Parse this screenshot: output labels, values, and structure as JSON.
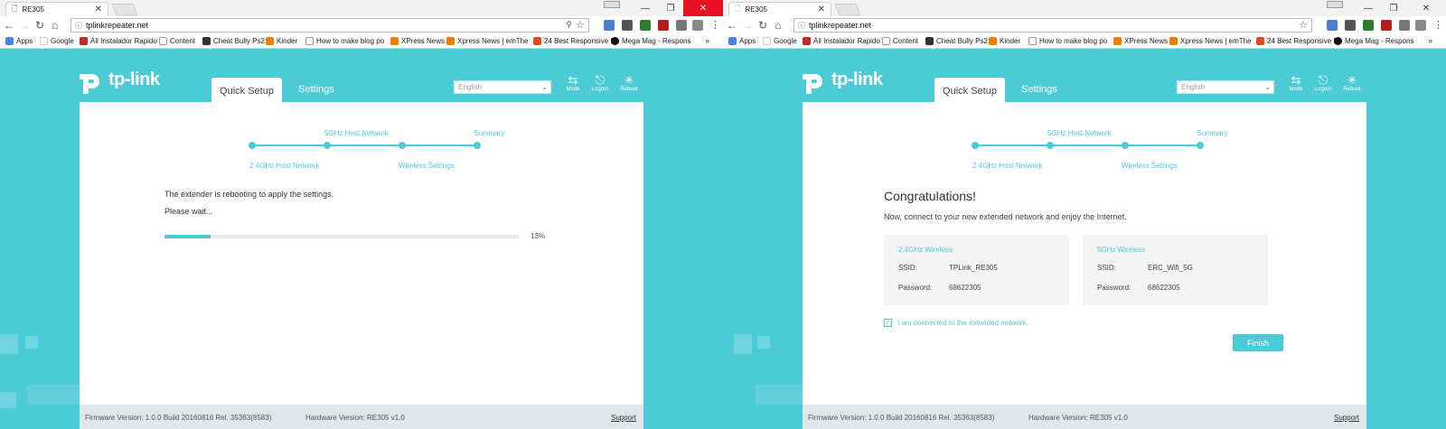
{
  "browser": {
    "tab_title": "RE305",
    "url": "tplinkrepeater.net",
    "bookmarks": [
      "Apps",
      "Google",
      "All Instalador Rapido",
      "Content",
      "Cheat Bully Ps2",
      "Kinder",
      "How to make blog po",
      "XPress News",
      "Xpress News | emThe",
      "24 Best Responsive Pr",
      "Mega Mag - Respons"
    ],
    "overflow": "»"
  },
  "router": {
    "brand": "tp-link",
    "tabs": [
      "Quick Setup",
      "Settings"
    ],
    "language": "English",
    "header_icons": [
      "Mode",
      "Logout",
      "Reboot"
    ],
    "steps_top": [
      "5GHz Host Network",
      "Summary"
    ],
    "steps_bottom": [
      "2.4GHz Host Network",
      "Wireless Settings"
    ],
    "footer": {
      "firmware": "Firmware Version: 1.0.0 Build 20160816 Rel. 35363(8583)",
      "hardware": "Hardware Version: RE305 v1.0",
      "support": "Support"
    }
  },
  "left": {
    "message": "The extender is rebooting to apply the settings.",
    "wait": "Please wait...",
    "progress_percent": 13,
    "progress_label": "13%"
  },
  "right": {
    "title": "Congratulations!",
    "subtitle": "Now, connect to your new extended network and enjoy the Internet.",
    "boxes": [
      {
        "heading": "2.4GHz Wireless",
        "ssid_label": "SSID:",
        "ssid": "TPLink_RE305",
        "pass_label": "Password:",
        "password": "68622305"
      },
      {
        "heading": "5GHz Wireless",
        "ssid_label": "SSID:",
        "ssid": "ERC_Wifi_5G",
        "pass_label": "Password:",
        "password": "68622305"
      }
    ],
    "checkbox_label": "I am connected to the extended network.",
    "finish": "Finish"
  },
  "colors": {
    "accent": "#4acbd6",
    "close_red": "#e81123"
  }
}
